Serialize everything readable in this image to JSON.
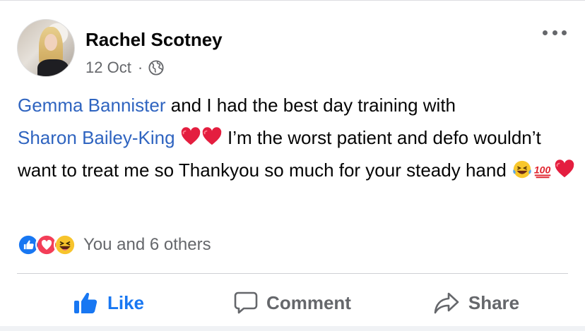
{
  "post": {
    "author": "Rachel Scotney",
    "date": "12 Oct",
    "separator": "·",
    "privacy_icon": "globe-icon",
    "more_icon": "more-options-icon",
    "text": {
      "mention1": "Gemma Bannister",
      "part1": " and I had the best day training with",
      "mention2": "Sharon Bailey-King",
      "part2": " I’m the worst patient and defo wouldn’t want to treat me so Thankyou so much for your steady hand "
    },
    "emojis": [
      "red-heart",
      "red-heart",
      "laughing-tears",
      "hundred-points",
      "red-heart"
    ]
  },
  "reactions": {
    "icons": [
      "like-reaction-icon",
      "love-reaction-icon",
      "haha-reaction-icon"
    ],
    "summary": "You and 6 others"
  },
  "actions": {
    "like": "Like",
    "comment": "Comment",
    "share": "Share"
  },
  "colors": {
    "link": "#2f64c0",
    "like_active": "#1877f2",
    "secondary_text": "#65676b"
  }
}
